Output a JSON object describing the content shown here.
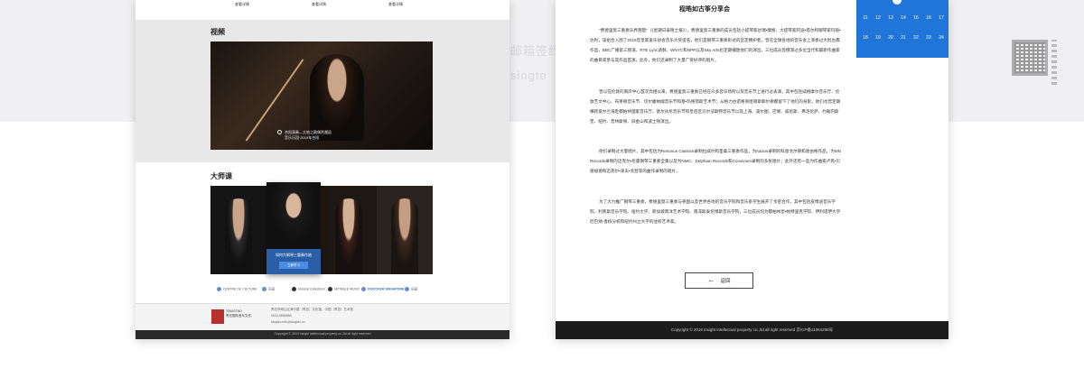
{
  "background": {
    "watermark_a": "邮箱签约文化",
    "watermark_b": "singto"
  },
  "left_page": {
    "top_links": [
      "查看详情",
      "查看详情",
      "查看详情"
    ],
    "video_section": {
      "title": "视频",
      "caption_line1": "合阳演奏—大地之歌偶然邂逅",
      "caption_line2": "音乐乐团·2019年合阳"
    },
    "masterclass_section": {
      "title": "大师课",
      "active_card_title": "如何为钢琴三重奏作曲",
      "active_card_button": "立即学习"
    },
    "partners": [
      "CENTRE DE CULTURE",
      "乐园",
      "Musical Collections",
      "NOTABLE MUSIC",
      "DISCOVER SINGAPORE",
      "乐园"
    ],
    "footer": {
      "logo_name": "TSINGTAO",
      "logo_sub": "青岛国际音乐文化",
      "address": "青岛市崂山区海尔路（青岛）文化馆，中国（青岛）艺术馆",
      "phone": "0532-8888888",
      "email": "singtao-info@singtao.cn",
      "copyright": "Copyright © 2019 insight intellectual property co.,ltd all right reserved"
    }
  },
  "right_page": {
    "article_title": "程皓如古筝分享会",
    "paragraphs": [
      "\"费德里莫三重奏乐界翘楚\"（《星期日泰晤士报》），费德里莫三重奏的成员包括小提琴家达瑞•摩根、大提琴家阿迪•塔尔和钢琴家玛丽•达利，该组合入围了2016年皇家爱乐协会音乐大奖提名，他们是钢琴三重奏形式的坚定拥护者，曾在全球各地的音乐会上演奏过大批古典作品，BBC广播第三频道、RTE Lyric调频、WNYC和NPR以及Sky Arts也定期播放他们的演出，三位成员皆擅演过多位当代和最新作曲家的曲目或参与其作品首演，此外，他们还录制了大量广受好评的唱片。",
      "曾以在伦敦的南岸中心首次亮相以来，费德里莫三重奏已经在众多音乐场所以及音乐节上进行过表演，其中包括威格摩尔音乐厅、伦敦艺文中心、布莱顿音乐节、切尔滕纳姆音乐节和塞•玛格努斯艺术节；从格力古诺格到哈德斯菲尔德都留下了他们的身影，他们也曾定期横跨爱尔兰海赴都柏林国家音乐厅，基尔肯尼音乐节和皇后区贝尔法斯特音乐节以及上海、波尔图、巴黎、威尼斯、弗洛伦萨、约翰内斯堡、纽约、普林斯顿、旧金山和波士顿演出。",
      "他们录制过大量唱片，其中包括为Resonus Classics录制拉威尔和圣桑三重奏作品，为Naxos录制的科恩戈尔德和勃伯格作品，为MN Records录制的迈克尔•尼曼钢琴三重奏全集以及为NMC、Delphian Records和Convivium录制的多张唱片；此外还有一些为作曲家卢克•贝德福德和迈克尔•泽夫•戈登等的曲作录制的唱片。",
      "为了大力推广钢琴三重奏，费德里莫三重奏与英国以及世界各地的音乐学院和音乐系学生展开了亲密合作，其中包括皮博迪音乐学院、利莱斯音乐学院、纽约大学、新加坡南洋艺术学院、南非斯泰伦博斯音乐学院，三位成员均为都柏林皇•帕特里克学院、伊利诺伊大学厄巴纳-香槟分校和纽约州立大学的驻校艺术家。"
    ],
    "calendar": {
      "row1": [
        "11",
        "12",
        "13",
        "14",
        "15",
        "16",
        "17"
      ],
      "row2": [
        "18",
        "19",
        "20",
        "21",
        "22",
        "23",
        "24"
      ]
    },
    "back_button": "返回",
    "footer_copyright": "Copyright © 2019 insight intellectual property co.,ltd all right reserved 京ICP备11064298号"
  }
}
